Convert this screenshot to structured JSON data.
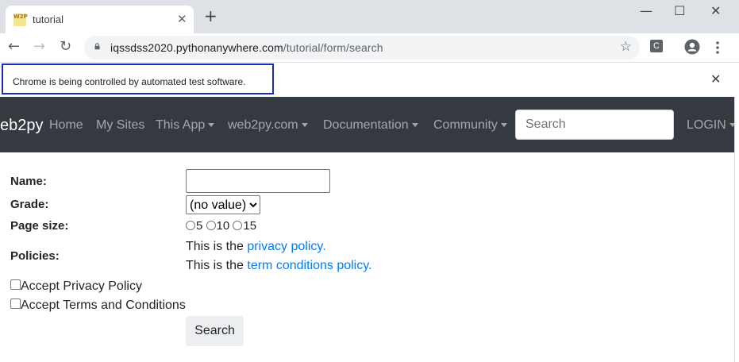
{
  "browser": {
    "tab_title": "tutorial",
    "tab_favicon_text": "W2P",
    "tab_close": "✕",
    "new_tab": "+",
    "window_controls": {
      "minimize": "—",
      "maximize": "☐",
      "close": "✕"
    },
    "url_domain": "iqssdss2020.pythonanywhere.com",
    "url_path": "/tutorial/form/search",
    "extension_label": "C",
    "infobar_text": "Chrome is being controlled by automated test software.",
    "infobar_close": "✕"
  },
  "navbar": {
    "brand": "eb2py",
    "links": [
      {
        "label": "Home"
      },
      {
        "label": "My Sites"
      },
      {
        "label": "This App"
      },
      {
        "label": "web2py.com"
      },
      {
        "label": "Documentation"
      },
      {
        "label": "Community"
      }
    ],
    "search_placeholder": "Search",
    "login": "LOGIN"
  },
  "form": {
    "name_label": "Name:",
    "name_value": "",
    "grade_label": "Grade:",
    "grade_selected": "(no value)",
    "page_size_label": "Page size:",
    "page_size_options": [
      "5",
      "10",
      "15"
    ],
    "policies_label": "Policies:",
    "policy_prefix": "This is the",
    "privacy_link": "privacy policy.",
    "terms_link": "term conditions policy.",
    "accept_privacy": "Accept Privacy Policy",
    "accept_terms": "Accept Terms and Conditions",
    "search_button": "Search"
  },
  "colors": {
    "navbar_bg": "#343a40",
    "link": "#007bff",
    "infobar_border": "#1a2cba"
  }
}
